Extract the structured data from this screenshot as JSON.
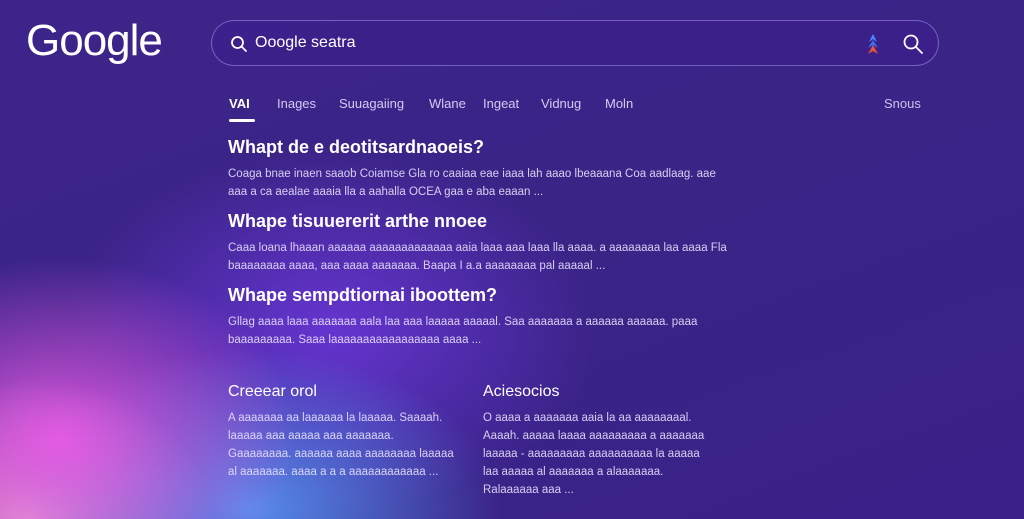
{
  "header": {
    "logo_text": "Google"
  },
  "search": {
    "query": "Ooogle seatra"
  },
  "tabs": [
    {
      "label": "VAI",
      "active": true
    },
    {
      "label": "Inages"
    },
    {
      "label": "Suuagaiing"
    },
    {
      "label": "Wlane"
    },
    {
      "label": "Ingeat"
    },
    {
      "label": "Vidnug"
    },
    {
      "label": "Moln"
    }
  ],
  "tools_label": "Snous",
  "results": [
    {
      "title": "Whapt de e deotitsardnaoeis?",
      "snippet": "Coaga bnae inaen saaob Coiamse Gla ro caaiaa eae iaaa lah aaao lbeaaana Coa aadlaag. aae aaa a ca aealae aaaia lla a aahalla OCEA gaa e aba eaaan ..."
    },
    {
      "title": "Whape tisuuererit arthe nnoee",
      "snippet": "Caaa loana lhaaan aaaaaa aaaaaaaaaaaaa aaia laaa aaa laaa lla aaaa. a aaaaaaaa laa aaaa Fla baaaaaaaa aaaa, aaa aaaa aaaaaaa. Baapa I a.a aaaaaaaa pal aaaaal ..."
    },
    {
      "title": "Whape sempdtiornai iboottem?",
      "snippet": "Gllag aaaa laaa aaaaaaa aala laa aaa laaaaa aaaaal. Saa aaaaaaa a aaaaaa aaaaaa. paaa baaaaaaaaa. Saaa laaaaaaaaaaaaaaaaa aaaa ..."
    }
  ],
  "cards": [
    {
      "title": "Creeear orol",
      "body": "A aaaaaaa aa laaaaaa la laaaaa. Saaaah. laaaaa aaa aaaaa aaa aaaaaaa. Gaaaaaaaa. aaaaaa aaaa aaaaaaaa laaaaa al aaaaaaa. aaaa a a a aaaaaaaaaaaa ..."
    },
    {
      "title": "Aciesocios",
      "body": "O aaaa a aaaaaaa aaia la aa aaaaaaaal. Aaaah. aaaaa laaaa aaaaaaaaa a aaaaaaa laaaaa - aaaaaaaaa aaaaaaaaaa la aaaaa laa aaaaa al aaaaaaa a alaaaaaaa. Ralaaaaaa aaa ..."
    }
  ],
  "colors": {
    "background": "#3b238a",
    "accent_pink": "#e85ae6",
    "accent_blue": "#5aa0ff",
    "text": "#ffffff"
  },
  "icons": {
    "search_left": "search-icon",
    "lens": "lens-icon",
    "search_right": "search-icon"
  }
}
